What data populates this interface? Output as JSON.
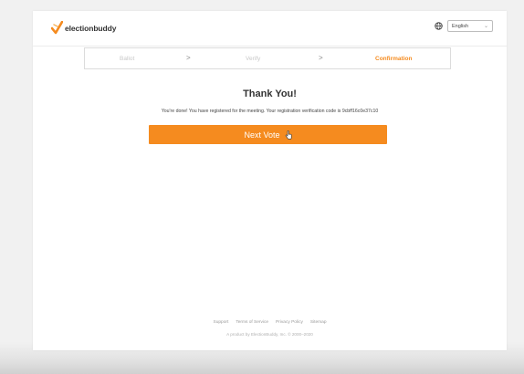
{
  "brand": {
    "name": "electionbuddy",
    "accent": "#f58b1f"
  },
  "language": {
    "selected": "English"
  },
  "steps": [
    {
      "label": "Ballot",
      "active": false
    },
    {
      "label": "Verify",
      "active": false
    },
    {
      "label": "Confirmation",
      "active": true
    }
  ],
  "step_separator": ">",
  "main": {
    "title": "Thank You!",
    "message": "You're done! You have registered for the meeting. Your registration verification code is 9cbff16c0e37c10",
    "next_button": "Next Vote"
  },
  "footer": {
    "links": [
      "Support",
      "Terms of Service",
      "Privacy Policy",
      "Sitemap"
    ],
    "copyright": "A product by ElectionBuddy, Inc. © 2000–2020"
  }
}
